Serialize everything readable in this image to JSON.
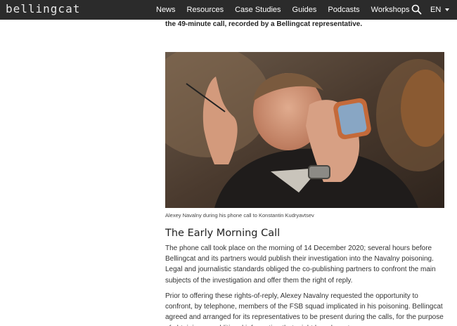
{
  "nav": {
    "logo": "bellingcat",
    "links": [
      "News",
      "Resources",
      "Case Studies",
      "Guides",
      "Podcasts",
      "Workshops"
    ],
    "language": "EN"
  },
  "article": {
    "intro_fragment": "the 49-minute call, recorded by a Bellingcat representative.",
    "photo_caption": "Alexey Navalny during his phone call to Konstantin Kudryavtsev",
    "section_heading": "The Early Morning Call",
    "paragraph1": "The phone call took place on the morning of 14 December 2020; several hours before Bellingcat and its partners would publish their investigation into the Navalny poisoning. Legal and journalistic standards obliged the co-publishing partners to confront the main subjects of the investigation and offer them the right of reply.",
    "paragraph2": "Prior to offering these rights-of-reply, Alexey Navalny requested the opportunity to confront, by telephone, members of the FSB squad implicated in his poisoning. Bellingcat agreed and arranged for its representatives to be present during the calls, for the purpose of obtaining an additional information that might be relevant..."
  }
}
